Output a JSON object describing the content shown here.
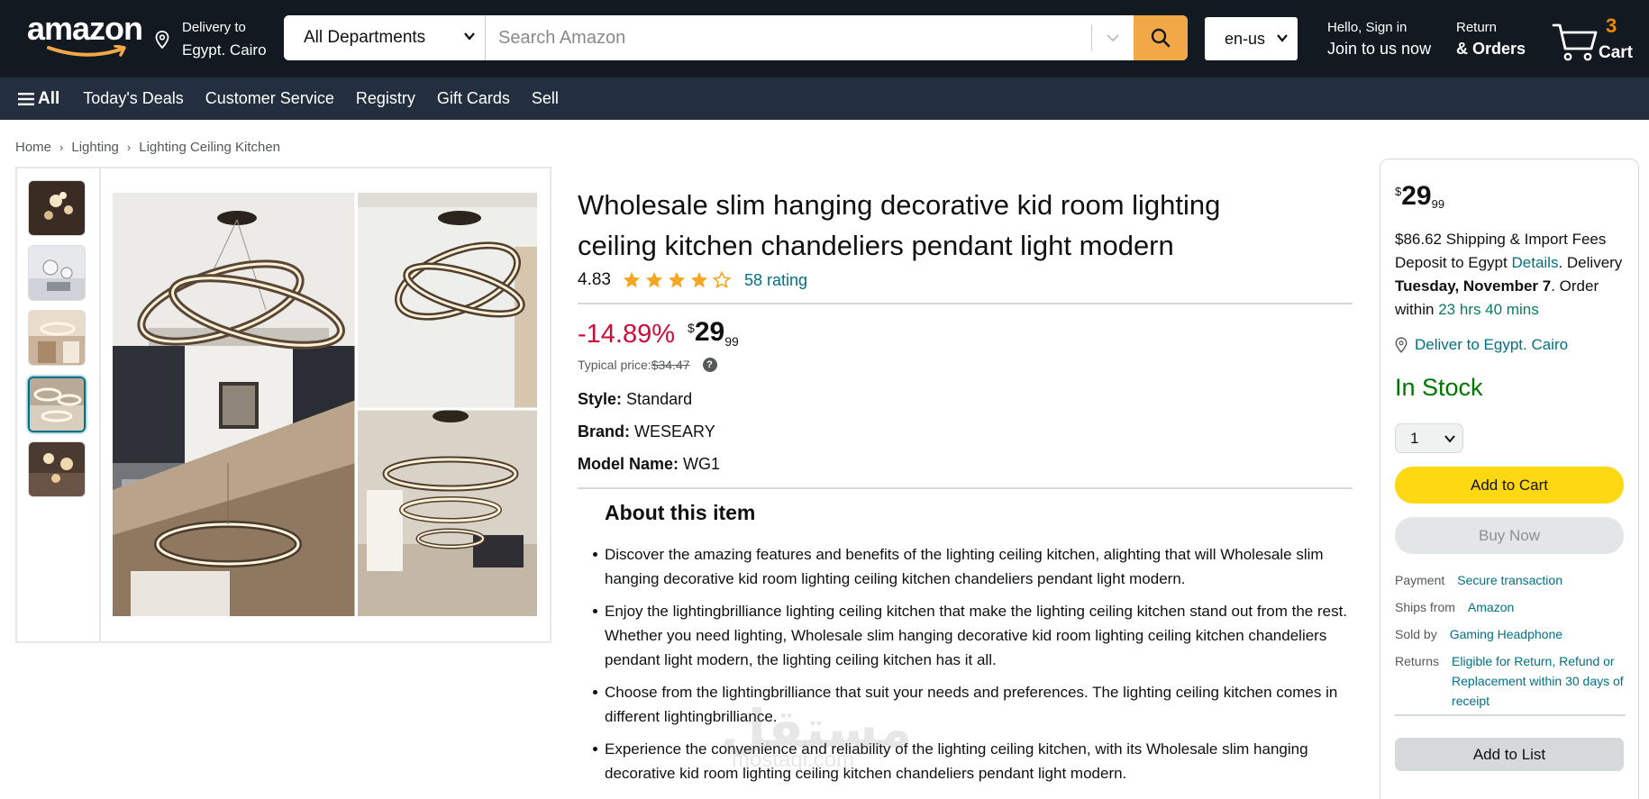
{
  "header": {
    "logo_text": "amazon",
    "delivery_label": "Delivery to",
    "delivery_location": "Egypt. Cairo",
    "search_department": "All Departments",
    "search_placeholder": "Search Amazon",
    "language": "en-us",
    "greeting": "Hello, Sign in",
    "account_link": "Join to us now",
    "returns_label": "Return",
    "orders_label": "& Orders",
    "cart_count": "3",
    "cart_label": "Cart",
    "icons": [
      "location-pin-icon",
      "chevron-down-icon",
      "search-icon",
      "cart-icon"
    ]
  },
  "nav": {
    "all_label": "All",
    "items": [
      "Today's Deals",
      "Customer Service",
      "Registry",
      "Gift Cards",
      "Sell"
    ]
  },
  "breadcrumb": [
    "Home",
    "Lighting",
    "Lighting Ceiling Kitchen"
  ],
  "product": {
    "title": "Wholesale slim hanging decorative kid room lighting ceiling kitchen chandeliers pendant light modern",
    "rating_value": "4.83",
    "stars_filled": 4,
    "stars_total": 5,
    "rating_count": "58 rating",
    "discount": "-14.89%",
    "price_symbol": "$",
    "price_whole": "29",
    "price_fraction": "99",
    "typical_label": "Typical price:",
    "typical_price": "$34.47",
    "specs": [
      {
        "label": "Style:",
        "value": "Standard"
      },
      {
        "label": "Brand:",
        "value": "WESEARY"
      },
      {
        "label": "Model Name:",
        "value": "WG1"
      }
    ],
    "about_title": "About this item",
    "bullets": [
      "Discover the amazing features and benefits of the lighting ceiling kitchen, alighting that will Wholesale slim hanging decorative kid room lighting ceiling kitchen chandeliers pendant light modern.",
      "Enjoy the lightingbrilliance lighting ceiling kitchen that make the lighting ceiling kitchen stand out from the rest. Whether you need lighting, Wholesale slim hanging decorative kid room lighting ceiling kitchen chandeliers pendant light modern, the lighting ceiling kitchen has it all.",
      "Choose from the lightingbrilliance that suit your needs and preferences. The lighting ceiling kitchen comes in different lightingbrilliance.",
      "Experience the convenience and reliability of the lighting ceiling kitchen, with its Wholesale slim hanging decorative kid room lighting ceiling kitchen chandeliers pendant light modern."
    ],
    "selected_thumbnail": 4
  },
  "buybox": {
    "price_symbol": "$",
    "price_whole": "29",
    "price_fraction": "99",
    "shipping_text": "$86.62 Shipping & Import Fees Deposit to Egypt",
    "details_link": "Details",
    "delivery_prefix": "Delivery",
    "delivery_date": "Tuesday, November 7",
    "order_within_prefix": "Order within",
    "order_within_time": "23 hrs 40 mins",
    "deliver_to": "Deliver to Egypt. Cairo",
    "stock": "In Stock",
    "quantity": "1",
    "add_to_cart": "Add to Cart",
    "buy_now": "Buy Now",
    "rows": [
      {
        "key": "Payment",
        "value": "Secure transaction"
      },
      {
        "key": "Ships from",
        "value": "Amazon"
      },
      {
        "key": "Sold by",
        "value": "Gaming Headphone"
      },
      {
        "key": "Returns",
        "value": "Eligible for Return, Refund or Replacement within 30 days of receipt"
      }
    ],
    "add_to_list": "Add to List"
  },
  "watermark": {
    "text": "مستقل",
    "subtext": "mostaql.com"
  },
  "colors": {
    "header_bg": "#131921",
    "nav_bg": "#232f3e",
    "search_button": "#f3a847",
    "cart_count": "#f08804",
    "link": "#007185",
    "discount": "#cc0c39",
    "in_stock": "#007600",
    "add_to_cart": "#ffd814",
    "star": "#f5a623"
  }
}
